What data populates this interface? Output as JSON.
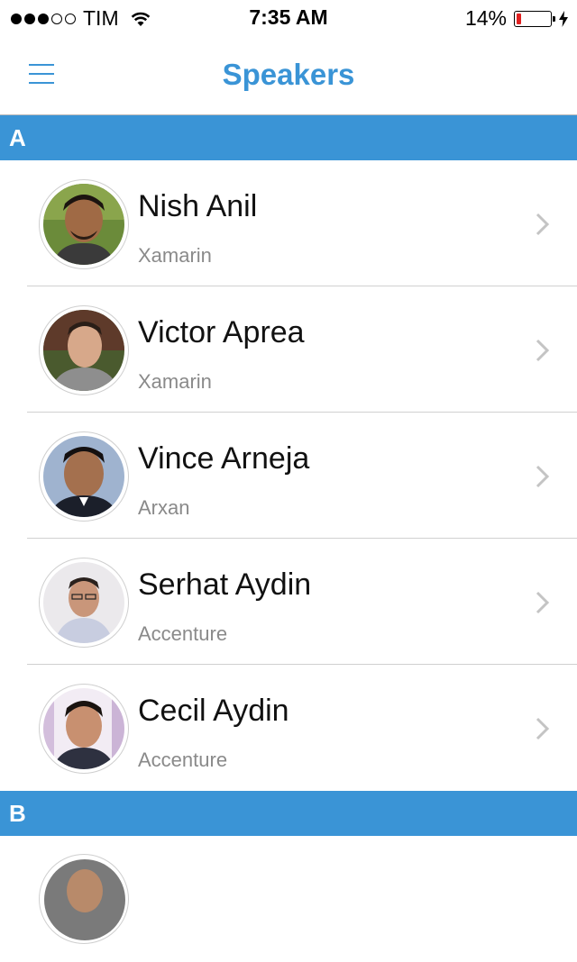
{
  "status_bar": {
    "carrier": "TIM",
    "time": "7:35 AM",
    "battery_percent": "14%",
    "battery_level": 0.14,
    "signal_bars": 3,
    "signal_total": 5,
    "icons": [
      "signal-dots",
      "wifi-icon",
      "battery-icon",
      "charging-bolt-icon"
    ]
  },
  "nav": {
    "title": "Speakers",
    "menu_icon": "hamburger-menu-icon",
    "accent_color": "#3a94d6"
  },
  "sections": [
    {
      "letter": "A",
      "speakers": [
        {
          "name": "Nish Anil",
          "company": "Xamarin"
        },
        {
          "name": "Victor Aprea",
          "company": "Xamarin"
        },
        {
          "name": "Vince Arneja",
          "company": "Arxan"
        },
        {
          "name": "Serhat Aydin",
          "company": "Accenture"
        },
        {
          "name": "Cecil Aydin",
          "company": "Accenture"
        }
      ]
    },
    {
      "letter": "B",
      "speakers": []
    }
  ]
}
